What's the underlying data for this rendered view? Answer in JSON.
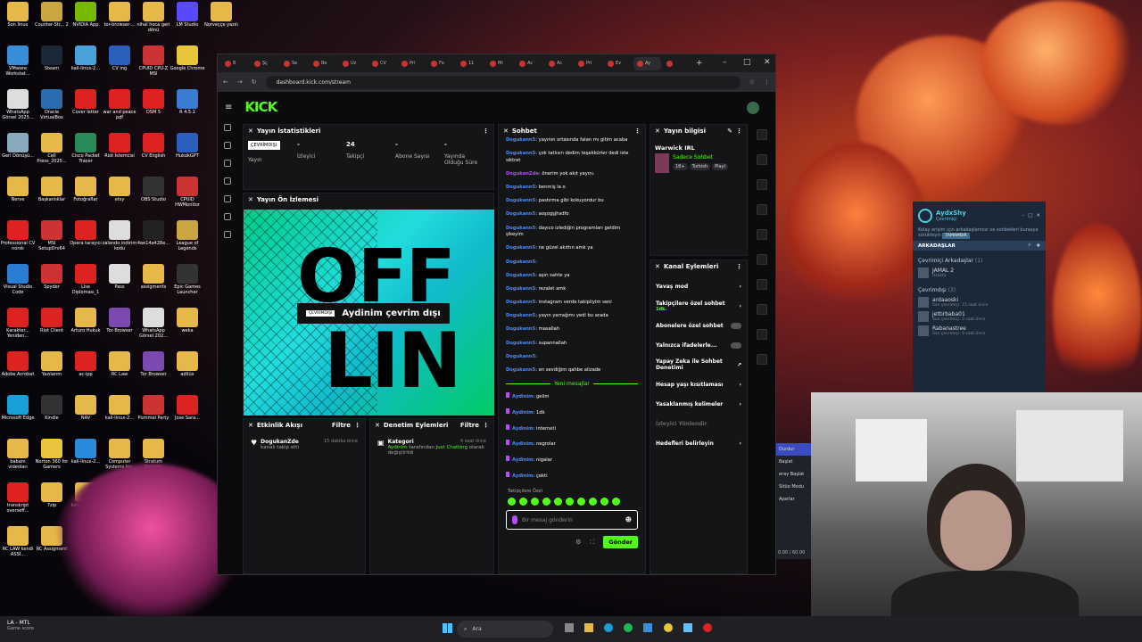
{
  "desktop": {
    "icons": [
      {
        "label": "Son linux",
        "col": 0,
        "row": 0,
        "color": "#e6b84a"
      },
      {
        "label": "Counter-Str... 2",
        "col": 1,
        "row": 0,
        "color": "#c9a640"
      },
      {
        "label": "NVIDIA App",
        "col": 2,
        "row": 0,
        "color": "#76b900"
      },
      {
        "label": "tor-browser-...",
        "col": 3,
        "row": 0,
        "color": "#e6b84a"
      },
      {
        "label": "nihal hoca geri dönü",
        "col": 4,
        "row": 0,
        "color": "#e6b84a"
      },
      {
        "label": "LM Studio",
        "col": 5,
        "row": 0,
        "color": "#5a4aff"
      },
      {
        "label": "Norveççe yazılı",
        "col": 6,
        "row": 0,
        "color": "#e6b84a"
      },
      {
        "label": "VMware Workstat...",
        "col": 0,
        "row": 1,
        "color": "#3a8dd8"
      },
      {
        "label": "Steam",
        "col": 1,
        "row": 1,
        "color": "#1b2838"
      },
      {
        "label": "kali-linux-2...",
        "col": 2,
        "row": 1,
        "color": "#4aa0d8"
      },
      {
        "label": "CV ing",
        "col": 3,
        "row": 1,
        "color": "#2b5fbe"
      },
      {
        "label": "CPUID CPU-Z MSI",
        "col": 4,
        "row": 1,
        "color": "#c33"
      },
      {
        "label": "Google Chrome",
        "col": 5,
        "row": 1,
        "color": "#e8c53a"
      },
      {
        "label": "WhatsApp Görsel 2025...",
        "col": 0,
        "row": 2,
        "color": "#ddd"
      },
      {
        "label": "Oracle VirtualBox",
        "col": 1,
        "row": 2,
        "color": "#2b6cb0"
      },
      {
        "label": "Cover letter",
        "col": 2,
        "row": 2,
        "color": "#d22"
      },
      {
        "label": "war and peace pdf",
        "col": 3,
        "row": 2,
        "color": "#d22"
      },
      {
        "label": "DSM 5",
        "col": 4,
        "row": 2,
        "color": "#d22"
      },
      {
        "label": "R 4.5.1",
        "col": 5,
        "row": 2,
        "color": "#3a7dd0"
      },
      {
        "label": "Geri Dönüşü...",
        "col": 0,
        "row": 3,
        "color": "#8ab"
      },
      {
        "label": "Cell Press_2025...",
        "col": 1,
        "row": 3,
        "color": "#e6b84a"
      },
      {
        "label": "Cisco Packet Tracer",
        "col": 2,
        "row": 3,
        "color": "#2a8a5a"
      },
      {
        "label": "Riot İstemcisi",
        "col": 3,
        "row": 3,
        "color": "#d22"
      },
      {
        "label": "CV English",
        "col": 4,
        "row": 3,
        "color": "#d22"
      },
      {
        "label": "HukukGPT",
        "col": 5,
        "row": 3,
        "color": "#2b5fbe"
      },
      {
        "label": "Nerve",
        "col": 0,
        "row": 4,
        "color": "#e6b84a"
      },
      {
        "label": "Başkanlıklar",
        "col": 1,
        "row": 4,
        "color": "#e6b84a"
      },
      {
        "label": "Fotoğraflar",
        "col": 2,
        "row": 4,
        "color": "#e6b84a"
      },
      {
        "label": "etsy",
        "col": 3,
        "row": 4,
        "color": "#e6b84a"
      },
      {
        "label": "OBS Studio",
        "col": 4,
        "row": 4,
        "color": "#333"
      },
      {
        "label": "CPUID HWMonitor",
        "col": 5,
        "row": 4,
        "color": "#c33"
      },
      {
        "label": "Professional CV norsk",
        "col": 0,
        "row": 5,
        "color": "#d22"
      },
      {
        "label": "MSI SetupDrv64",
        "col": 1,
        "row": 5,
        "color": "#c33"
      },
      {
        "label": "Opera tarayıcı",
        "col": 2,
        "row": 5,
        "color": "#d22"
      },
      {
        "label": "zalando indirim kodu",
        "col": 3,
        "row": 5,
        "color": "#ddd"
      },
      {
        "label": "4ee14a428e...",
        "col": 4,
        "row": 5,
        "color": "#222"
      },
      {
        "label": "League of Legends",
        "col": 5,
        "row": 5,
        "color": "#c9a640"
      },
      {
        "label": "Visual Studio Code",
        "col": 0,
        "row": 6,
        "color": "#2b7cd3"
      },
      {
        "label": "Spyder",
        "col": 1,
        "row": 6,
        "color": "#c33"
      },
      {
        "label": "Lise Diploması_1",
        "col": 2,
        "row": 6,
        "color": "#d22"
      },
      {
        "label": "Pass",
        "col": 3,
        "row": 6,
        "color": "#ddd"
      },
      {
        "label": "assigments",
        "col": 4,
        "row": 6,
        "color": "#e6b84a"
      },
      {
        "label": "Epic Games Launcher",
        "col": 5,
        "row": 6,
        "color": "#333"
      },
      {
        "label": "Karakter... Yeniden...",
        "col": 0,
        "row": 7,
        "color": "#d22"
      },
      {
        "label": "Riot Client",
        "col": 1,
        "row": 7,
        "color": "#d22"
      },
      {
        "label": "Arturo Hukuk",
        "col": 2,
        "row": 7,
        "color": "#e6b84a"
      },
      {
        "label": "Tor Browser",
        "col": 3,
        "row": 7,
        "color": "#7a4ab0"
      },
      {
        "label": "WhatsApp Görsel 202...",
        "col": 4,
        "row": 7,
        "color": "#ddd"
      },
      {
        "label": "weka",
        "col": 5,
        "row": 7,
        "color": "#e6b84a"
      },
      {
        "label": "Adobe Acrobat",
        "col": 0,
        "row": 8,
        "color": "#d22"
      },
      {
        "label": "Yazılarım",
        "col": 1,
        "row": 8,
        "color": "#e6b84a"
      },
      {
        "label": "ac-ipp",
        "col": 2,
        "row": 8,
        "color": "#d22"
      },
      {
        "label": "RC Law",
        "col": 3,
        "row": 8,
        "color": "#e6b84a"
      },
      {
        "label": "Tor Browser",
        "col": 4,
        "row": 8,
        "color": "#7a4ab0"
      },
      {
        "label": "adilüx",
        "col": 5,
        "row": 8,
        "color": "#e6b84a"
      },
      {
        "label": "Microsoft Edge",
        "col": 0,
        "row": 9,
        "color": "#1aa0d8"
      },
      {
        "label": "Kindle",
        "col": 1,
        "row": 9,
        "color": "#333"
      },
      {
        "label": "NAV",
        "col": 2,
        "row": 9,
        "color": "#e6b84a"
      },
      {
        "label": "kali-linux-2...",
        "col": 3,
        "row": 9,
        "color": "#e6b84a"
      },
      {
        "label": "Pummel Party",
        "col": 4,
        "row": 9,
        "color": "#c33"
      },
      {
        "label": "Jose Sara...",
        "col": 5,
        "row": 9,
        "color": "#d22"
      },
      {
        "label": "babam videoları",
        "col": 0,
        "row": 10,
        "color": "#e6b84a"
      },
      {
        "label": "Norton 360 for Gamers",
        "col": 1,
        "row": 10,
        "color": "#e8c53a"
      },
      {
        "label": "kali-linux-2...",
        "col": 2,
        "row": 10,
        "color": "#2b8ad8"
      },
      {
        "label": "Computer Systems Inc.",
        "col": 3,
        "row": 10,
        "color": "#e6b84a"
      },
      {
        "label": "Stratum Reliable",
        "col": 4,
        "row": 10,
        "color": "#e6b84a"
      },
      {
        "label": "transkript overseff...",
        "col": 0,
        "row": 11,
        "color": "#d22"
      },
      {
        "label": "7zip",
        "col": 1,
        "row": 11,
        "color": "#e6b84a"
      },
      {
        "label": "kali-linux-2...",
        "col": 2,
        "row": 11,
        "color": "#e6b84a"
      },
      {
        "label": "RC LAW kendi ASSI...",
        "col": 0,
        "row": 12,
        "color": "#e6b84a"
      },
      {
        "label": "RC Assigment",
        "col": 1,
        "row": 12,
        "color": "#e6b84a"
      }
    ]
  },
  "browser": {
    "tabs": [
      "8",
      "Şç",
      "Se",
      "Be",
      "Uz",
      "CV",
      "Pri",
      "Fo",
      "11",
      "Mi",
      "Ac",
      "Ac",
      "Pri",
      "Ev",
      "Ay",
      ""
    ],
    "url": "dashboard.kick.com/stream",
    "new_tab": "+",
    "min": "–",
    "max": "□",
    "close": "✕"
  },
  "kick": {
    "logo": "KICK",
    "stats": {
      "title": "Yayın İstatistikleri",
      "status_badge": "ÇEVRİMDIŞI",
      "status_label": "Yayın",
      "items": [
        {
          "value": "-",
          "label": "İzleyici"
        },
        {
          "value": "24",
          "label": "Takipçi"
        },
        {
          "value": "-",
          "label": "Abone Sayısı"
        },
        {
          "value": "-",
          "label": "Yayında Olduğu Süre"
        }
      ]
    },
    "preview": {
      "title": "Yayın Ön İzlemesi",
      "badge": "ÇEVRİMDIŞI",
      "text": "Aydinim çevrim dışı",
      "art_top": "OFF",
      "art_bottom": "LIN"
    },
    "activity": {
      "title": "Etkinlik Akışı",
      "filter": "Filtre",
      "user": "DogukanZde",
      "desc": "kanalı takip etti",
      "time": "15 dakika önce"
    },
    "moderation": {
      "title": "Denetim Eylemleri",
      "filter": "Filtre",
      "head": "Kategori",
      "time": "4 saat önce",
      "user": "Aydinim",
      "mid": "tarafından",
      "cat": "Just Chatting",
      "tail": "olarak değiştirildi"
    },
    "chat": {
      "title": "Sohbet",
      "new_messages": "Yeni mesajlar",
      "followers_only": "Takipçilere Özel",
      "placeholder": "Bir mesaj gönderin",
      "send": "Gönder",
      "messages": [
        {
          "user": "Dogukann5",
          "text": "yayının ortasında falan mı gitim acaba",
          "color": "#4b8bff"
        },
        {
          "user": "Dogukann5",
          "text": "çok tatlısın dedim teşekkürler dedi iste siktret",
          "color": "#4b8bff"
        },
        {
          "user": "DogukanZde",
          "text": "önerim yok akıt yayını.",
          "color": "#b44bff"
        },
        {
          "user": "Dogukann5",
          "text": "benmiş la o",
          "color": "#4b8bff"
        },
        {
          "user": "Dogukann5",
          "text": "pastırma gibi kokuyordur bu",
          "color": "#4b8bff"
        },
        {
          "user": "Dogukann5",
          "text": "aoşogşjhsdfo",
          "color": "#4b8bff"
        },
        {
          "user": "Dogukann5",
          "text": "dayıco izlediğin programları geldim şikeyim",
          "color": "#4b8bff"
        },
        {
          "user": "Dogukann5",
          "text": "ne güzel akıttın amk ya",
          "color": "#4b8bff"
        },
        {
          "user": "Dogukann5",
          "text": "",
          "color": "#4b8bff"
        },
        {
          "user": "Dogukann5",
          "text": "aşırı sahte ya",
          "color": "#4b8bff"
        },
        {
          "user": "Dogukann5",
          "text": "rezalet amk",
          "color": "#4b8bff"
        },
        {
          "user": "Dogukann5",
          "text": "instagram verde takipliyim seni",
          "color": "#4b8bff"
        },
        {
          "user": "Dogukann5",
          "text": "yayın yarrağımı yedi bu arada",
          "color": "#4b8bff"
        },
        {
          "user": "Dogukann5",
          "text": "masallah",
          "color": "#4b8bff"
        },
        {
          "user": "Dogukann5",
          "text": "supannallah",
          "color": "#4b8bff"
        },
        {
          "user": "Dogukann5",
          "text": "",
          "color": "#4b8bff"
        },
        {
          "user": "Dogukann5",
          "text": "en sevdiğim qahbe alizade",
          "color": "#4b8bff"
        }
      ],
      "new": [
        {
          "user": "Aydinim",
          "text": "gelim"
        },
        {
          "user": "Aydinim",
          "text": "1dk"
        },
        {
          "user": "Aydinim",
          "text": "interneti"
        },
        {
          "user": "Aydinim",
          "text": "negrolar"
        },
        {
          "user": "Aydinim",
          "text": "nigalar"
        },
        {
          "user": "Aydinim",
          "text": "çekti"
        }
      ]
    },
    "info": {
      "title": "Yayın bilgisi",
      "stream_title": "Warwick IRL",
      "category": "Sadece Sohbet",
      "tags": [
        "18+",
        "Turkish",
        "Playl"
      ]
    },
    "channel": {
      "title": "Kanal Eylemleri",
      "items": [
        {
          "label": "Yavaş mod",
          "sub": "",
          "ctl": "arrow"
        },
        {
          "label": "Takipçilere özel sohbet",
          "sub": "1dk.",
          "ctl": "arrow"
        },
        {
          "label": "Abonelere özel sohbet",
          "sub": "",
          "ctl": "toggle"
        },
        {
          "label": "Yalnızca ifadelerle...",
          "sub": "",
          "ctl": "toggle"
        },
        {
          "label": "Yapay Zeka ile Sohbet Denetimi",
          "sub": "",
          "ctl": "ext"
        },
        {
          "label": "Hesap yaşı kısıtlaması",
          "sub": "",
          "ctl": "arrow"
        },
        {
          "label": "Yasaklanmış kelimeler",
          "sub": "",
          "ctl": "arrow"
        },
        {
          "label": "İzleyici Yönlendir",
          "sub": "",
          "ctl": "none"
        },
        {
          "label": "Hedefleri belirleyin",
          "sub": "",
          "ctl": "arrow"
        }
      ]
    }
  },
  "steam": {
    "user": "AydxShy",
    "status": "Çevrimiçi",
    "notice": "Kolay erişim için arkadaşlarınızı ve sohbetleri burasya sürükleyin",
    "notice_btn": "TAMAMDIR",
    "section": "ARKADAŞLAR",
    "ingame_header": "Çevrimiçi Arkadaşlar",
    "ingame_count": "(1)",
    "ingame": [
      {
        "name": "JAMAL 2",
        "sub": "Uzakta"
      }
    ],
    "offline_header": "Çevrimdışı",
    "offline_count": "(3)",
    "offline": [
      {
        "name": "ardaaoski",
        "sub": "Son çevrimiçi: 15 saat önce"
      },
      {
        "name": "jettirbaba01",
        "sub": "Son çevrimiçi: 2 saat önce"
      },
      {
        "name": "Rabanastree",
        "sub": "Son çevrimiçi: 6 saat önce"
      }
    ]
  },
  "obs": {
    "items": [
      "Durdur",
      "Başlat",
      "eray Başlat",
      "Sitüo Modu",
      "Ayarlar"
    ],
    "time": "0.00 / 60.00"
  },
  "taskbar": {
    "weather": "LA - MTL",
    "weather_sub": "Game score",
    "search": "Ara"
  }
}
